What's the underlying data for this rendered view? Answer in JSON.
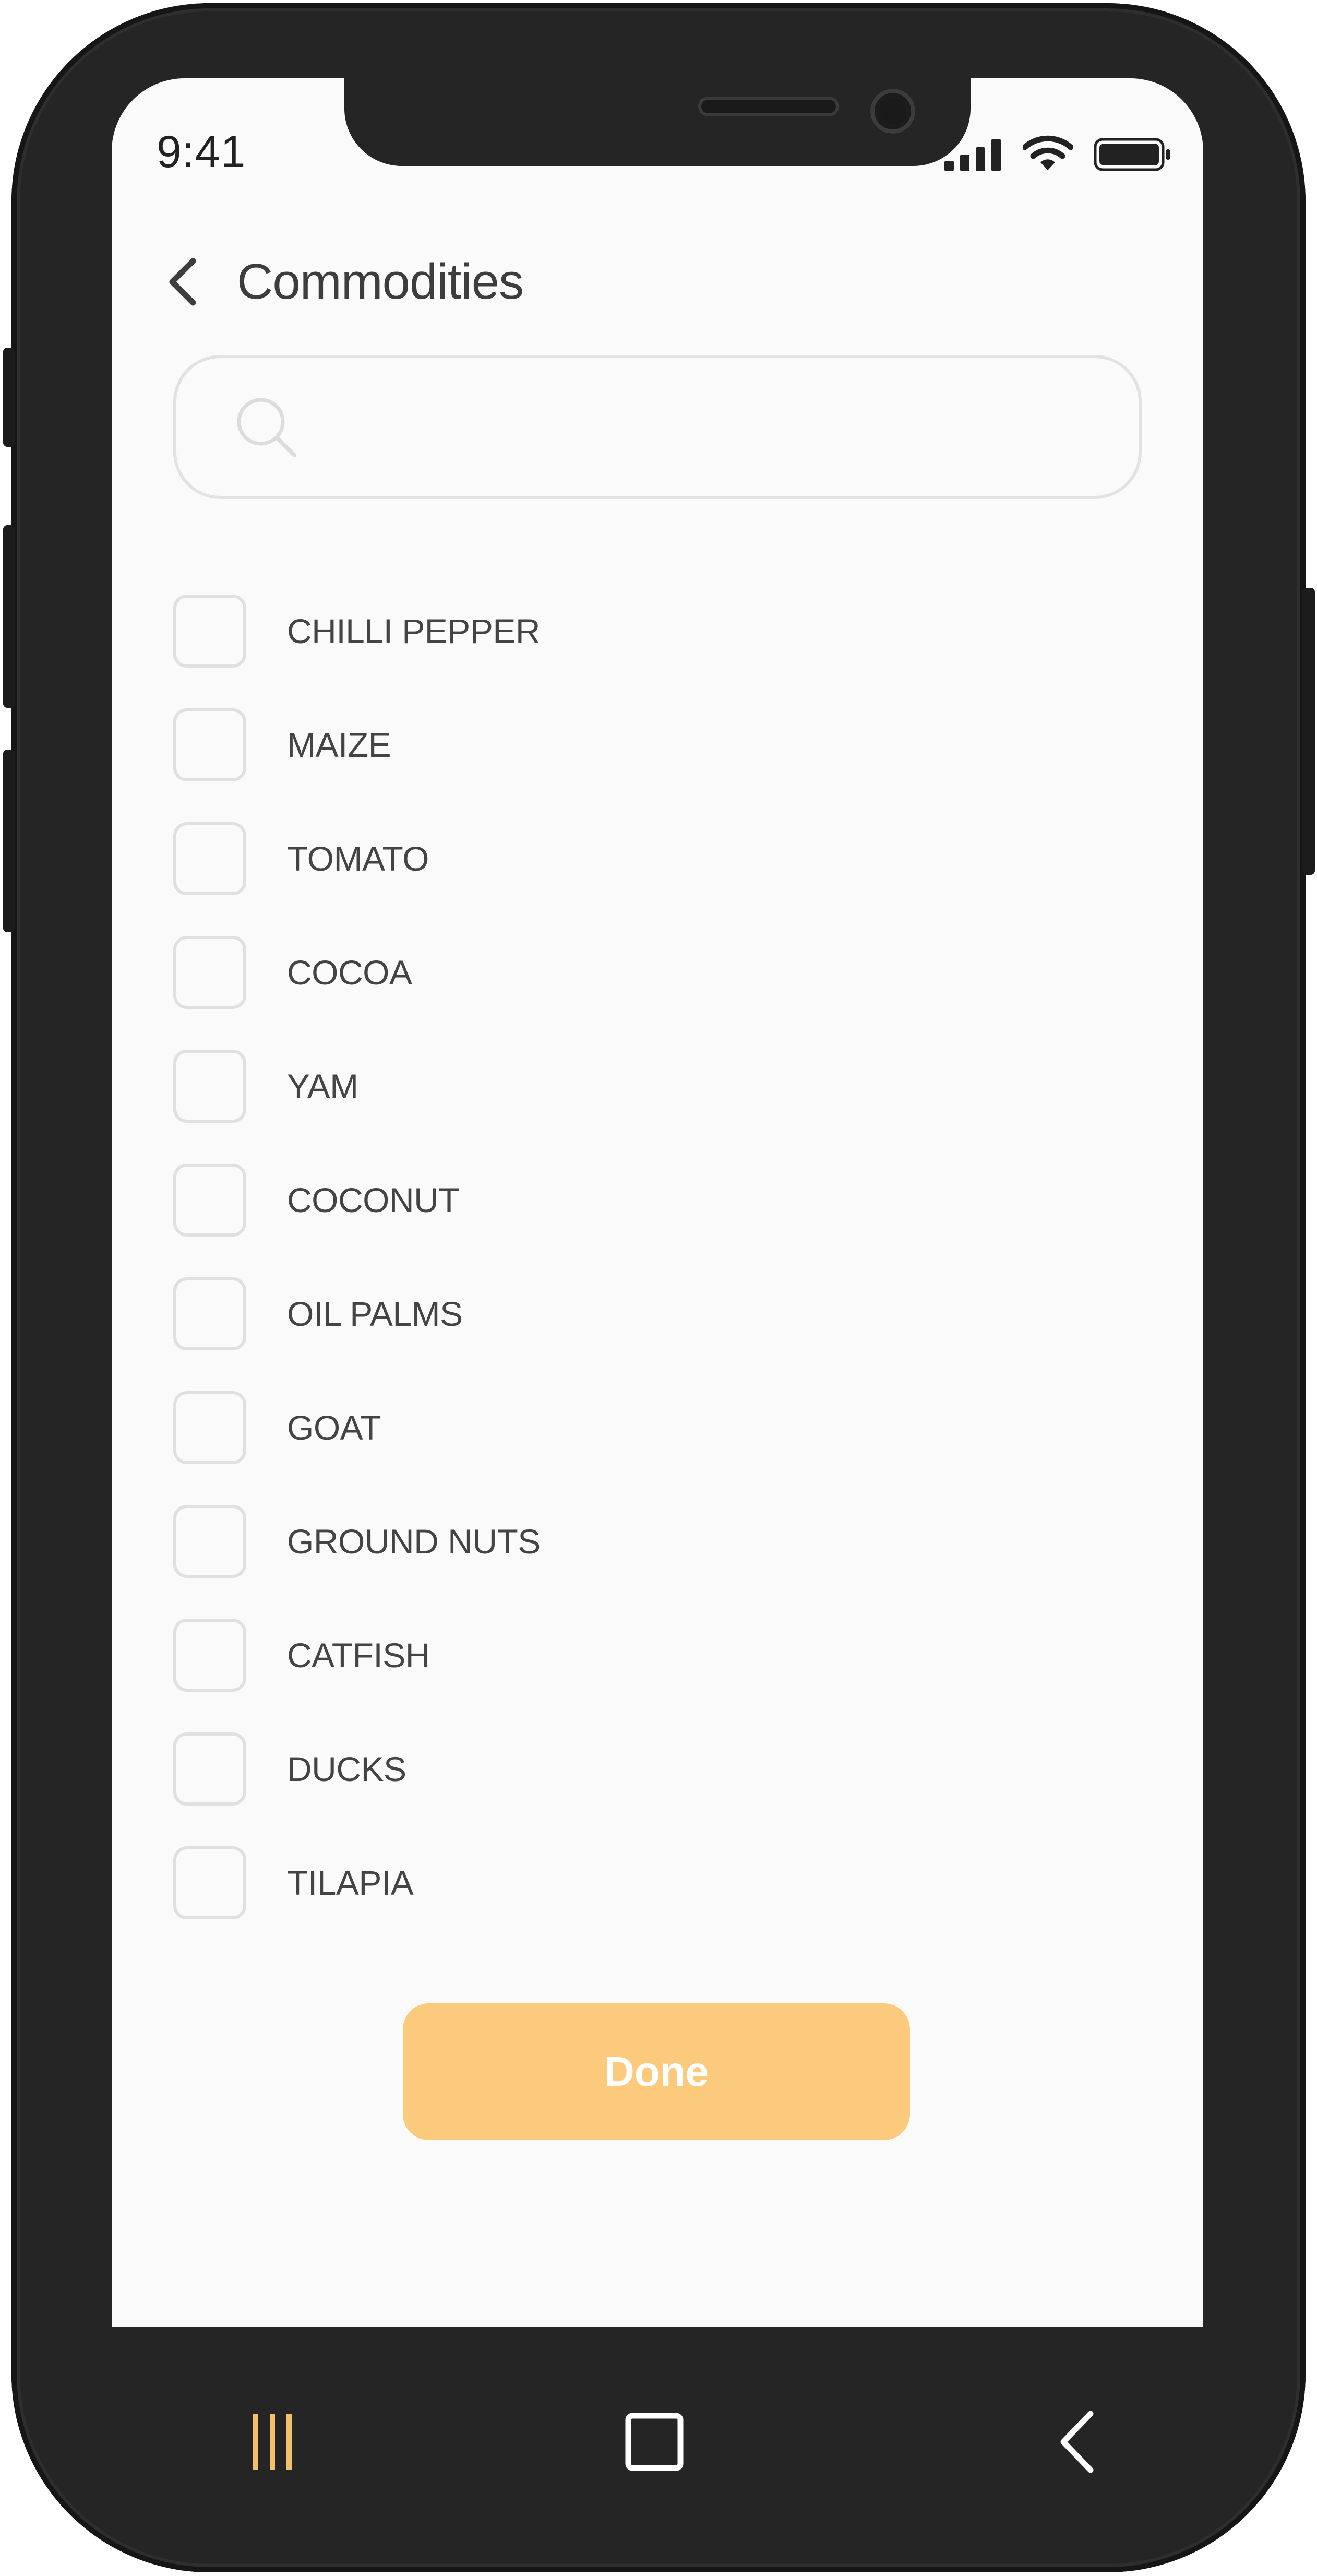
{
  "status_bar": {
    "time": "9:41",
    "icons": [
      "signal-icon",
      "wifi-icon",
      "battery-icon"
    ]
  },
  "header": {
    "back_icon": "chevron-left-icon",
    "title": "Commodities"
  },
  "search": {
    "icon": "search-icon",
    "value": "",
    "placeholder": ""
  },
  "commodities": [
    {
      "label": "CHILLI PEPPER",
      "checked": false
    },
    {
      "label": "MAIZE",
      "checked": false
    },
    {
      "label": "TOMATO",
      "checked": false
    },
    {
      "label": "COCOA",
      "checked": false
    },
    {
      "label": "YAM",
      "checked": false
    },
    {
      "label": "COCONUT",
      "checked": false
    },
    {
      "label": "OIL PALMS",
      "checked": false
    },
    {
      "label": "GOAT",
      "checked": false
    },
    {
      "label": "GROUND NUTS",
      "checked": false
    },
    {
      "label": "CATFISH",
      "checked": false
    },
    {
      "label": "DUCKS",
      "checked": false
    },
    {
      "label": "TILAPIA",
      "checked": false
    }
  ],
  "done_button": {
    "label": "Done"
  },
  "nav_bar": {
    "recents_icon": "recents-icon",
    "home_icon": "home-square-icon",
    "back_icon": "back-chevron-icon"
  },
  "colors": {
    "accent": "#fcca7d",
    "nav_accent": "#f5c06a",
    "frame": "#252525",
    "screen_bg": "#fafafa",
    "text": "#444444"
  }
}
